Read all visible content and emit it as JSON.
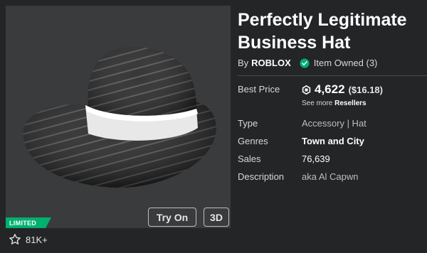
{
  "item": {
    "title_line1": "Perfectly Legitimate",
    "title_line2": "Business Hat",
    "by_label": "By",
    "creator": "ROBLOX",
    "owned_text": "Item Owned (3)",
    "limited_badge": "LIMITED",
    "favorites": "81K+"
  },
  "buttons": {
    "try_on": "Try On",
    "three_d": "3D"
  },
  "price": {
    "label": "Best Price",
    "amount": "4,622",
    "usd": "($16.18)",
    "resellers_prefix": "See more",
    "resellers_link": "Resellers"
  },
  "details": {
    "type_label": "Type",
    "type_value": "Accessory | Hat",
    "genres_label": "Genres",
    "genres_value": "Town and City",
    "sales_label": "Sales",
    "sales_value": "76,639",
    "description_label": "Description",
    "description_value": "aka Al Capwn"
  },
  "icons": {
    "owned": "check-circle-icon",
    "currency": "robux-icon",
    "favorite": "star-outline-icon"
  },
  "colors": {
    "background": "#232527",
    "thumbnail_bg": "#393b3d",
    "limited_green": "#00b06f",
    "owned_green": "#00b06f"
  }
}
